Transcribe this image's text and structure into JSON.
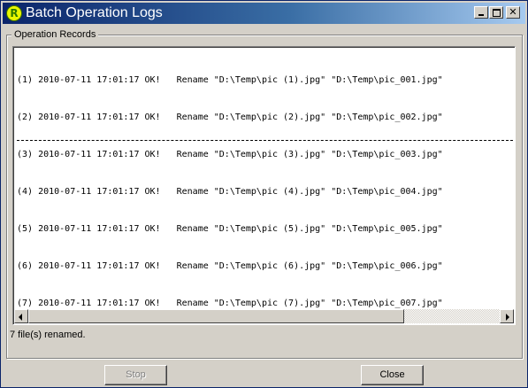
{
  "window": {
    "title": "Batch Operation Logs",
    "icon": "app-r-icon",
    "icon_letter": "R",
    "controls": [
      "minimize",
      "maximize",
      "close"
    ]
  },
  "group": {
    "label": "Operation Records"
  },
  "log": {
    "lines": [
      "(1) 2010-07-11 17:01:17 OK!   Rename \"D:\\Temp\\pic (1).jpg\" \"D:\\Temp\\pic_001.jpg\"",
      "(2) 2010-07-11 17:01:17 OK!   Rename \"D:\\Temp\\pic (2).jpg\" \"D:\\Temp\\pic_002.jpg\"",
      "(3) 2010-07-11 17:01:17 OK!   Rename \"D:\\Temp\\pic (3).jpg\" \"D:\\Temp\\pic_003.jpg\"",
      "(4) 2010-07-11 17:01:17 OK!   Rename \"D:\\Temp\\pic (4).jpg\" \"D:\\Temp\\pic_004.jpg\"",
      "(5) 2010-07-11 17:01:17 OK!   Rename \"D:\\Temp\\pic (5).jpg\" \"D:\\Temp\\pic_005.jpg\"",
      "(6) 2010-07-11 17:01:17 OK!   Rename \"D:\\Temp\\pic (6).jpg\" \"D:\\Temp\\pic_006.jpg\"",
      "(7) 2010-07-11 17:01:17 OK!   Rename \"D:\\Temp\\pic (7).jpg\" \"D:\\Temp\\pic_007.jpg\""
    ]
  },
  "status": {
    "text": "7 file(s) renamed."
  },
  "buttons": {
    "stop_label": "Stop",
    "close_label": "Close"
  },
  "colors": {
    "title_gradient_start": "#0a246a",
    "title_gradient_end": "#a6caf0",
    "face": "#d4d0c8",
    "disabled_text": "#808080"
  }
}
